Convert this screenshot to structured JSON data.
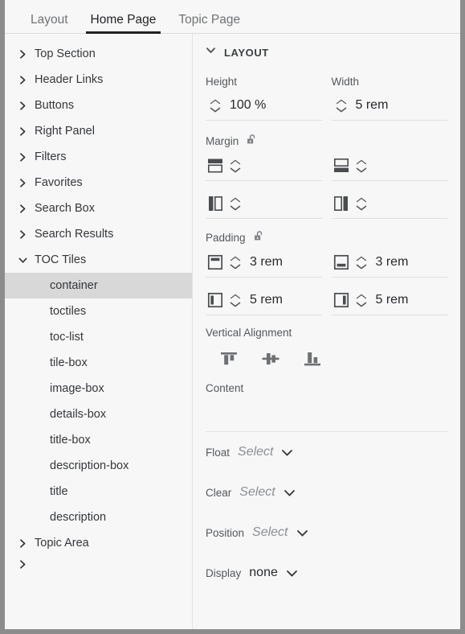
{
  "tabs": [
    {
      "label": "Layout",
      "active": false
    },
    {
      "label": "Home Page",
      "active": true
    },
    {
      "label": "Topic Page",
      "active": false
    }
  ],
  "sidebar": {
    "items": [
      {
        "label": "Top Section",
        "type": "group",
        "expanded": false
      },
      {
        "label": "Header Links",
        "type": "group",
        "expanded": false
      },
      {
        "label": "Buttons",
        "type": "group",
        "expanded": false
      },
      {
        "label": "Right Panel",
        "type": "group",
        "expanded": false
      },
      {
        "label": "Filters",
        "type": "group",
        "expanded": false
      },
      {
        "label": "Favorites",
        "type": "group",
        "expanded": false
      },
      {
        "label": "Search Box",
        "type": "group",
        "expanded": false
      },
      {
        "label": "Search Results",
        "type": "group",
        "expanded": false
      },
      {
        "label": "TOC Tiles",
        "type": "group",
        "expanded": true
      },
      {
        "label": "container",
        "type": "child",
        "selected": true
      },
      {
        "label": "toctiles",
        "type": "child",
        "selected": false
      },
      {
        "label": "toc-list",
        "type": "child",
        "selected": false
      },
      {
        "label": "tile-box",
        "type": "child",
        "selected": false
      },
      {
        "label": "image-box",
        "type": "child",
        "selected": false
      },
      {
        "label": "details-box",
        "type": "child",
        "selected": false
      },
      {
        "label": "title-box",
        "type": "child",
        "selected": false
      },
      {
        "label": "description-box",
        "type": "child",
        "selected": false
      },
      {
        "label": "title",
        "type": "child",
        "selected": false
      },
      {
        "label": "description",
        "type": "child",
        "selected": false
      },
      {
        "label": "Topic Area",
        "type": "group",
        "expanded": false
      }
    ]
  },
  "panel": {
    "section_title": "LAYOUT",
    "height": {
      "label": "Height",
      "value": "100 %"
    },
    "width": {
      "label": "Width",
      "value": "5 rem"
    },
    "margin": {
      "label": "Margin",
      "lock": "unlocked",
      "top": "",
      "bottom": "",
      "left": "",
      "right": ""
    },
    "padding": {
      "label": "Padding",
      "lock": "unlocked",
      "top": "3 rem",
      "bottom": "3 rem",
      "left": "5 rem",
      "right": "5 rem"
    },
    "vertical_alignment": {
      "label": "Vertical Alignment",
      "options": [
        "align-top",
        "align-middle",
        "align-bottom"
      ],
      "selected": ""
    },
    "content": {
      "label": "Content",
      "value": ""
    },
    "float": {
      "label": "Float",
      "value": "Select",
      "is_placeholder": true
    },
    "clear": {
      "label": "Clear",
      "value": "Select",
      "is_placeholder": true
    },
    "position": {
      "label": "Position",
      "value": "Select",
      "is_placeholder": true
    },
    "display": {
      "label": "Display",
      "value": "none",
      "is_placeholder": false
    }
  },
  "colors": {
    "background": "#f7f7f7",
    "selected_row": "#d8d8d8",
    "text": "#34373b",
    "muted_text": "#54585c",
    "placeholder": "#8c9094",
    "icon": "#4a4d50",
    "active_tab_underline": "#1f2124",
    "window_border": "#8c8c8c"
  }
}
